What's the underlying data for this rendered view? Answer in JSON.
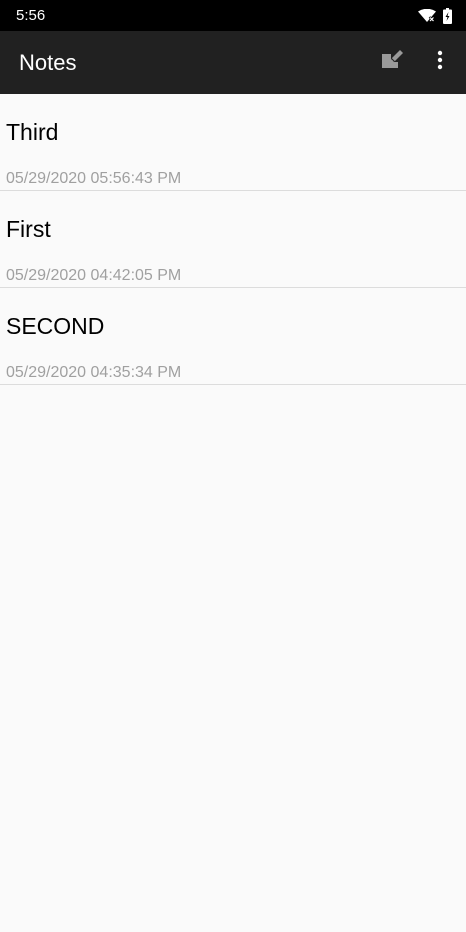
{
  "status_bar": {
    "time": "5:56",
    "icons": [
      "wifi-icon",
      "battery-icon"
    ]
  },
  "app_bar": {
    "title": "Notes",
    "actions": [
      "new-note-icon",
      "overflow-menu-icon"
    ]
  },
  "notes": [
    {
      "title": "Third",
      "date": "05/29/2020 05:56:43 PM"
    },
    {
      "title": "First",
      "date": "05/29/2020 04:42:05 PM"
    },
    {
      "title": "SECOND",
      "date": "05/29/2020 04:35:34 PM"
    }
  ],
  "colors": {
    "status_bar": "#000000",
    "app_bar": "#212121",
    "background": "#fafafa",
    "date_text": "#a0a0a0",
    "divider": "#dcdcdc"
  }
}
